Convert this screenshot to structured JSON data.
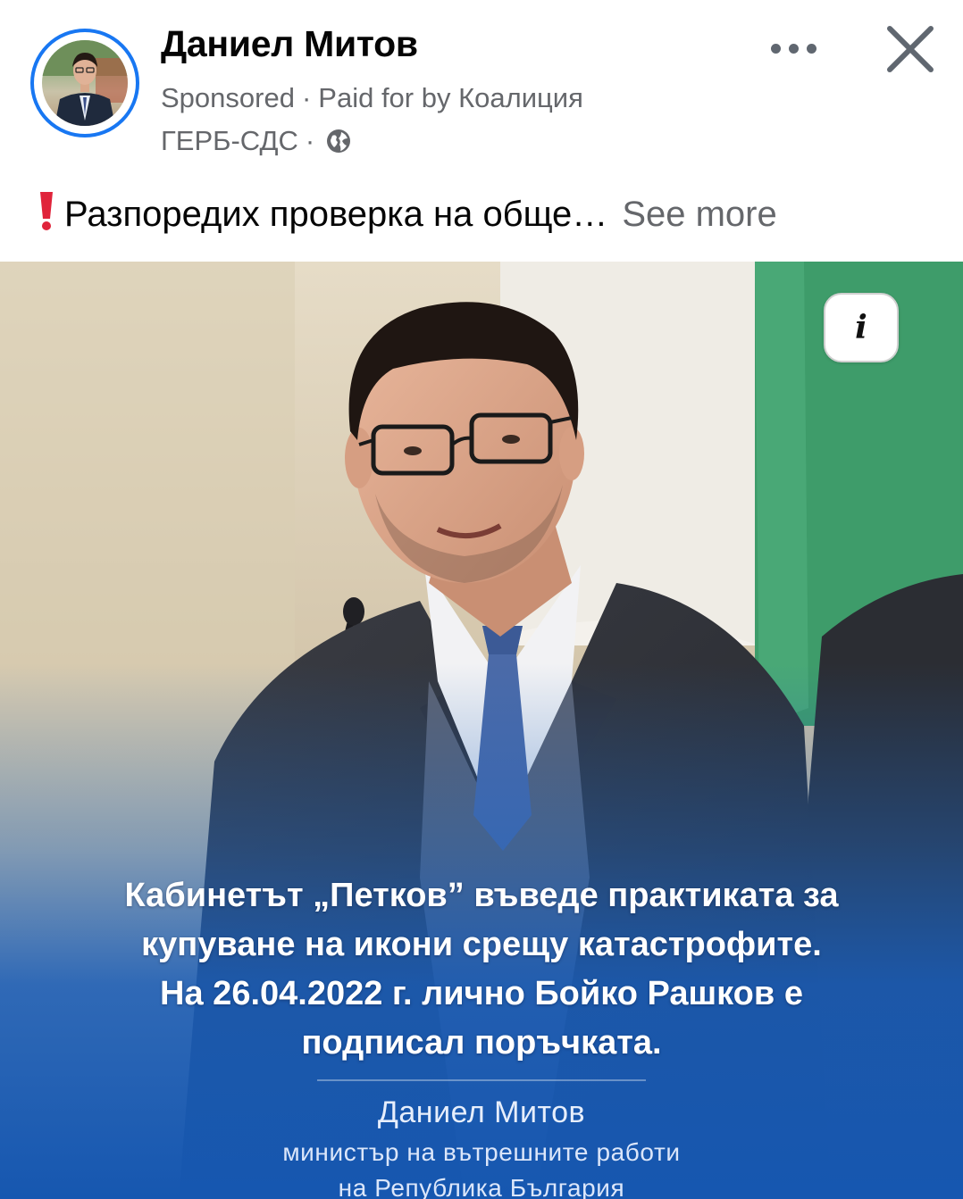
{
  "post": {
    "author": "Даниел Митов",
    "sponsored_label": "Sponsored",
    "separator": "·",
    "paid_for_line1": "Paid for by Коалиция",
    "paid_for_line2": "ГЕРБ-СДС",
    "privacy_icon": "globe-icon",
    "more_icon": "more-dots-icon",
    "close_icon": "close-icon",
    "caption_icon": "exclamation-icon",
    "caption_text": "Разпоредих проверка на обще…",
    "see_more": "See more"
  },
  "media": {
    "info_icon": "info-icon",
    "info_glyph": "i",
    "overlay_lines": [
      "Кабинетът „Петков” въведе практиката за",
      "купуване на икони срещу катастрофите.",
      "На 26.04.2022 г. лично Бойко Рашков е",
      "подписал поръчката."
    ],
    "signature_name": "Даниел Митов",
    "signature_title_line1": "министър на вътрешните работи",
    "signature_title_line2": "на Република България"
  },
  "colors": {
    "brand_blue": "#1877f2",
    "secondary_text": "#65676b",
    "overlay_blue": "#1b5fb8",
    "flag_white": "#f4f1ec",
    "flag_green": "#3e9c6a",
    "exclamation_red": "#e0243b"
  }
}
